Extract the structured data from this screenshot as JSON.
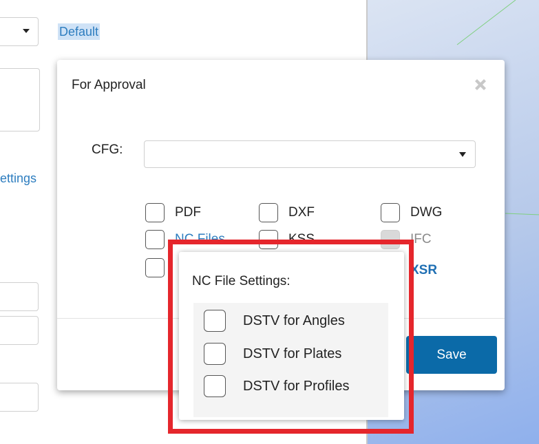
{
  "background": {
    "default_link": "Default",
    "settings_link_fragment": "ettings"
  },
  "dialog": {
    "title_value": "For Approval",
    "cfg_label": "CFG:",
    "cfg_value": "",
    "options": [
      {
        "label": "PDF",
        "checked": false,
        "style": "normal"
      },
      {
        "label": "DXF",
        "checked": false,
        "style": "normal"
      },
      {
        "label": "DWG",
        "checked": false,
        "style": "normal"
      },
      {
        "label": "NC Files",
        "checked": false,
        "style": "link"
      },
      {
        "label": "KSS",
        "checked": false,
        "style": "normal"
      },
      {
        "label": "IFC",
        "checked": false,
        "style": "disabled"
      },
      {
        "label": "XSR",
        "checked": false,
        "style": "bold-link"
      }
    ],
    "save_label": "Save"
  },
  "nc_popover": {
    "title": "NC File Settings:",
    "options": [
      {
        "label": "DSTV for Angles",
        "checked": false
      },
      {
        "label": "DSTV for Plates",
        "checked": false
      },
      {
        "label": "DSTV for Profiles",
        "checked": false
      }
    ]
  },
  "colors": {
    "accent": "#2d7dbf",
    "save_button": "#0b6aa8",
    "highlight": "#e5262c"
  }
}
